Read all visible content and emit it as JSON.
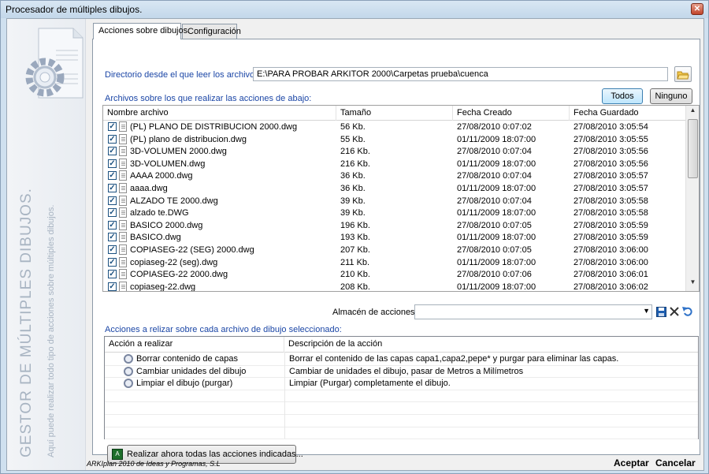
{
  "window": {
    "title": "Procesador de múltiples dibujos."
  },
  "sidebar": {
    "vertical_title": "GESTOR DE MÚLTIPLES DIBUJOS.",
    "vertical_subtitle": "Aquí puede realizar todo tipo de acciones sobre múltiples dibujos."
  },
  "tabs": [
    {
      "label": "Acciones sobre dibujos.",
      "active": true
    },
    {
      "label": "Configuración",
      "active": false
    }
  ],
  "directory": {
    "label": "Directorio desde el que leer los archivos:",
    "value": "E:\\PARA PROBAR ARKITOR 2000\\Carpetas prueba\\cuenca"
  },
  "files": {
    "label": "Archivos sobre los que realizar las acciones de abajo:",
    "all_button": "Todos",
    "none_button": "Ninguno",
    "columns": [
      "Nombre archivo",
      "Tamaño",
      "Fecha Creado",
      "Fecha Guardado"
    ],
    "rows": [
      {
        "name": "(PL) PLANO DE DISTRIBUCION 2000.dwg",
        "size": "56 Kb.",
        "created": "27/08/2010 0:07:02",
        "saved": "27/08/2010 3:05:54",
        "checked": true
      },
      {
        "name": "(PL) plano de distribucion.dwg",
        "size": "55 Kb.",
        "created": "01/11/2009 18:07:00",
        "saved": "27/08/2010 3:05:55",
        "checked": true
      },
      {
        "name": "3D-VOLUMEN 2000.dwg",
        "size": "216 Kb.",
        "created": "27/08/2010 0:07:04",
        "saved": "27/08/2010 3:05:56",
        "checked": true
      },
      {
        "name": "3D-VOLUMEN.dwg",
        "size": "216 Kb.",
        "created": "01/11/2009 18:07:00",
        "saved": "27/08/2010 3:05:56",
        "checked": true
      },
      {
        "name": "AAAA 2000.dwg",
        "size": "36 Kb.",
        "created": "27/08/2010 0:07:04",
        "saved": "27/08/2010 3:05:57",
        "checked": true
      },
      {
        "name": "aaaa.dwg",
        "size": "36 Kb.",
        "created": "01/11/2009 18:07:00",
        "saved": "27/08/2010 3:05:57",
        "checked": true
      },
      {
        "name": "ALZADO TE 2000.dwg",
        "size": "39 Kb.",
        "created": "27/08/2010 0:07:04",
        "saved": "27/08/2010 3:05:58",
        "checked": true
      },
      {
        "name": "alzado te.DWG",
        "size": "39 Kb.",
        "created": "01/11/2009 18:07:00",
        "saved": "27/08/2010 3:05:58",
        "checked": true
      },
      {
        "name": "BASICO 2000.dwg",
        "size": "196 Kb.",
        "created": "27/08/2010 0:07:05",
        "saved": "27/08/2010 3:05:59",
        "checked": true
      },
      {
        "name": "BASICO.dwg",
        "size": "193 Kb.",
        "created": "01/11/2009 18:07:00",
        "saved": "27/08/2010 3:05:59",
        "checked": true
      },
      {
        "name": "COPIASEG-22 (SEG) 2000.dwg",
        "size": "207 Kb.",
        "created": "27/08/2010 0:07:05",
        "saved": "27/08/2010 3:06:00",
        "checked": true
      },
      {
        "name": "copiaseg-22 (seg).dwg",
        "size": "211 Kb.",
        "created": "01/11/2009 18:07:00",
        "saved": "27/08/2010 3:06:00",
        "checked": true
      },
      {
        "name": "COPIASEG-22 2000.dwg",
        "size": "210 Kb.",
        "created": "27/08/2010 0:07:06",
        "saved": "27/08/2010 3:06:01",
        "checked": true
      },
      {
        "name": "copiaseg-22.dwg",
        "size": "208 Kb.",
        "created": "01/11/2009 18:07:00",
        "saved": "27/08/2010 3:06:02",
        "checked": true
      }
    ]
  },
  "store": {
    "label": "Almacén de acciones:",
    "value": ""
  },
  "actions": {
    "label": "Acciones a relizar sobre cada archivo de dibujo seleccionado:",
    "columns": [
      "Acción a realizar",
      "Descripción de la acción"
    ],
    "rows": [
      {
        "action": "Borrar contenido de capas",
        "description": "Borrar el contenido de las capas capa1,capa2,pepe* y purgar para eliminar las capas."
      },
      {
        "action": "Cambiar unidades del dibujo",
        "description": "Cambiar de unidades el dibujo, pasar de Metros a Milímetros"
      },
      {
        "action": "Limpiar el dibujo (purgar)",
        "description": "Limpiar (Purgar) completamente el dibujo."
      }
    ],
    "run_button": "Realizar ahora todas las acciones indicadas..."
  },
  "footer": {
    "copyright": "ARKIplan 2010 de Ideas y Programas, S.L",
    "accept": "Aceptar",
    "cancel": "Cancelar"
  },
  "colors": {
    "accent_text": "#1b46a6",
    "save_icon": "#1f5fb0"
  },
  "icons": [
    "close-icon",
    "folder-icon",
    "save-icon",
    "delete-icon",
    "undo-icon",
    "gear-icon",
    "autocad-icon",
    "document-gear-icon"
  ]
}
